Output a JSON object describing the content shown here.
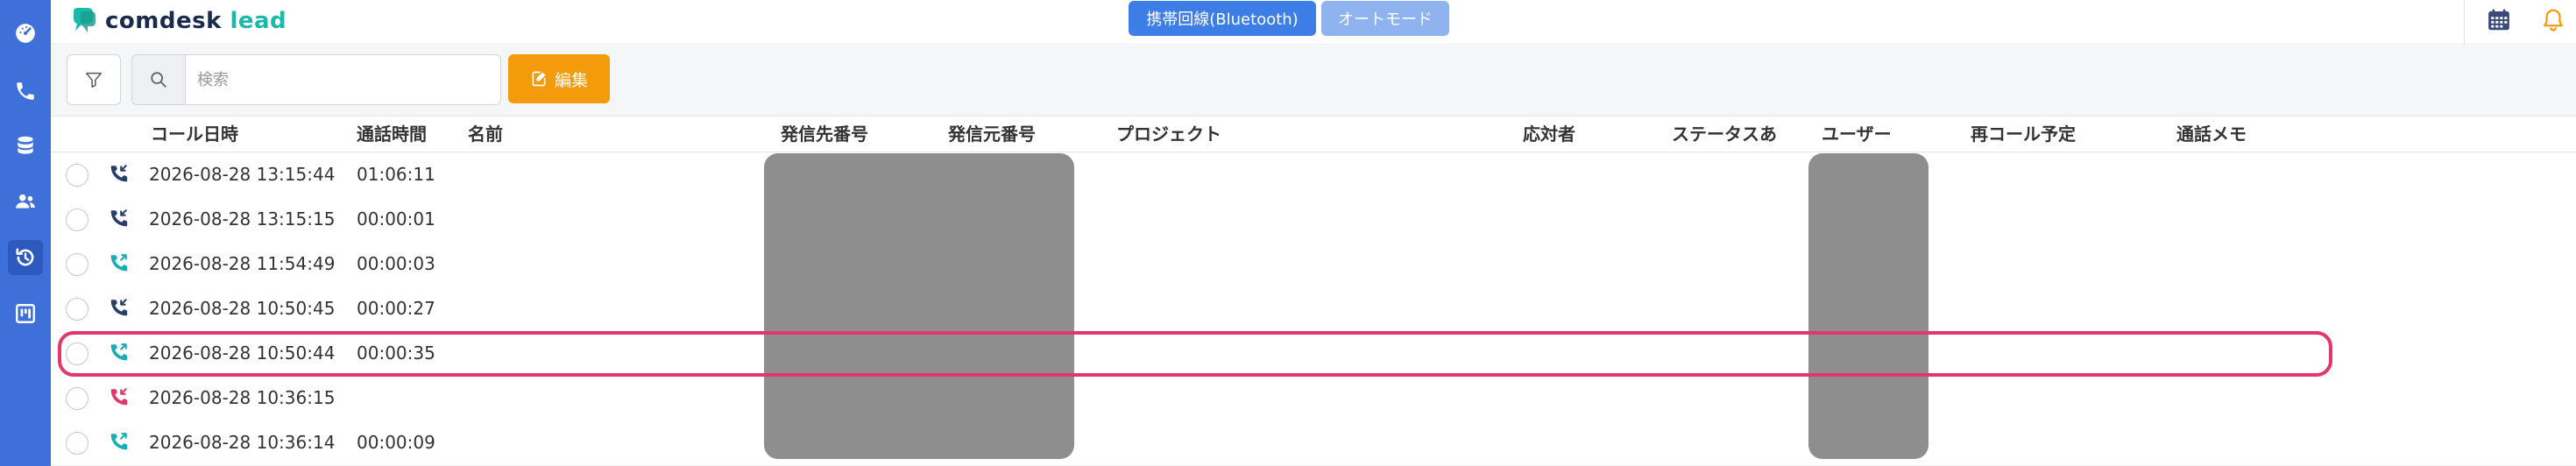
{
  "app": {
    "logo_text_main": "comdesk",
    "logo_text_accent": "lead",
    "brand_color": "#3f6fd8",
    "accent_color": "#1bb9a9"
  },
  "sidebar": {
    "items": [
      {
        "name": "dashboard",
        "icon": "speedometer-icon",
        "active": false
      },
      {
        "name": "phone",
        "icon": "phone-icon",
        "active": false
      },
      {
        "name": "database",
        "icon": "database-icon",
        "active": false
      },
      {
        "name": "contacts",
        "icon": "users-icon",
        "active": false
      },
      {
        "name": "call-history",
        "icon": "history-icon",
        "active": true
      },
      {
        "name": "board",
        "icon": "kanban-icon",
        "active": false
      }
    ]
  },
  "header": {
    "mobile_line_label": "携帯回線(Bluetooth)",
    "auto_mode_label": "オートモード",
    "calendar_icon": "calendar-icon",
    "bell_icon": "bell-icon"
  },
  "toolbar": {
    "filter_icon": "filter-icon",
    "search_icon": "search-icon",
    "search_placeholder": "検索",
    "search_value": "",
    "edit_label": "編集",
    "edit_icon": "edit-icon",
    "edit_color": "#f49b0b"
  },
  "table": {
    "headers": {
      "call_datetime": "コール日時",
      "duration": "通話時間",
      "name": "名前",
      "to_number": "発信先番号",
      "from_number": "発信元番号",
      "project": "プロジェクト",
      "responder": "応対者",
      "status": "ステータスあ",
      "user": "ユーザー",
      "recall": "再コール予定",
      "memo": "通話メモ"
    },
    "rows": [
      {
        "direction": "incoming",
        "icon": "incoming-call-icon",
        "datetime": "2026-08-28 13:15:44",
        "duration": "01:06:11"
      },
      {
        "direction": "incoming",
        "icon": "incoming-call-icon",
        "datetime": "2026-08-28 13:15:15",
        "duration": "00:00:01"
      },
      {
        "direction": "outgoing",
        "icon": "outgoing-call-icon",
        "datetime": "2026-08-28 11:54:49",
        "duration": "00:00:03"
      },
      {
        "direction": "incoming",
        "icon": "incoming-call-icon",
        "datetime": "2026-08-28 10:50:45",
        "duration": "00:00:27"
      },
      {
        "direction": "outgoing",
        "icon": "outgoing-call-icon",
        "datetime": "2026-08-28 10:50:44",
        "duration": "00:00:35",
        "highlighted": true
      },
      {
        "direction": "missed",
        "icon": "missed-call-icon",
        "datetime": "2026-08-28 10:36:15",
        "duration": ""
      },
      {
        "direction": "outgoing",
        "icon": "outgoing-call-icon",
        "datetime": "2026-08-28 10:36:14",
        "duration": "00:00:09"
      }
    ]
  },
  "colors": {
    "incoming": "#2b3f6b",
    "outgoing": "#18aeb3",
    "missed": "#e2366c",
    "highlight": "#e2366c",
    "redaction": "#8e8e8e"
  }
}
